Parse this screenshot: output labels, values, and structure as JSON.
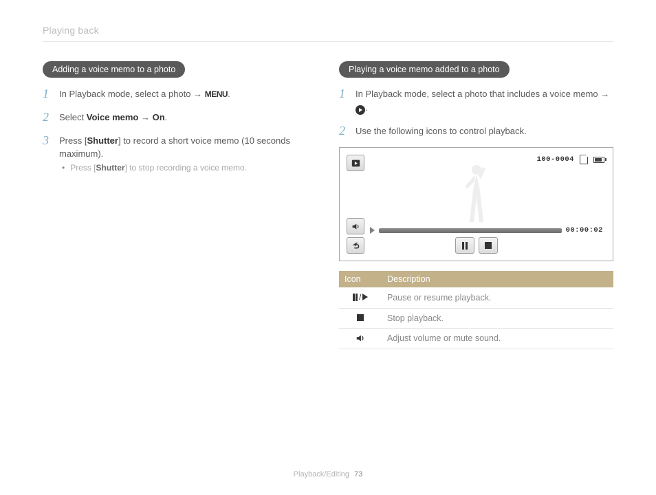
{
  "header": {
    "title": "Playing back"
  },
  "left": {
    "pill": "Adding a voice memo to a photo",
    "step1_pre": "In Playback mode, select a photo ",
    "menu_glyph": "MENU",
    "step2_pre": "Select ",
    "step2_bold1": "Voice memo",
    "step2_mid": " → ",
    "step2_bold2": "On",
    "step3_pre": "Press [",
    "step3_bold": "Shutter",
    "step3_post": "] to record a short voice memo (10 seconds maximum).",
    "bullet1_pre": "Press [",
    "bullet1_bold": "Shutter",
    "bullet1_post": "] to stop recording a voice memo."
  },
  "right": {
    "pill": "Playing a voice memo added to a photo",
    "step1_text": "In Playback mode, select a photo that includes a voice memo → ",
    "step2_text": "Use the following icons to control playback.",
    "cam": {
      "file": "100-0004",
      "time": "00:00:02"
    },
    "table": {
      "h_icon": "Icon",
      "h_desc": "Description",
      "r1": "Pause or resume playback.",
      "r2": "Stop playback.",
      "r3": "Adjust volume or mute sound."
    }
  },
  "footer": {
    "section": "Playback/Editing",
    "page": "73"
  }
}
